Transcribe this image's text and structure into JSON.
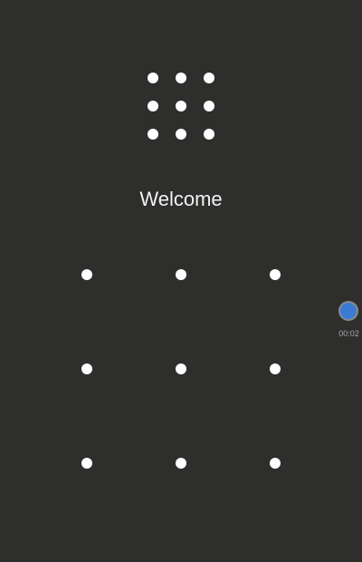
{
  "screen": {
    "title": "Welcome"
  },
  "pattern_preview": {
    "rows": 3,
    "cols": 3
  },
  "pattern_lock": {
    "rows": 3,
    "cols": 3
  },
  "recording_indicator": {
    "time": "00:02",
    "color": "#3a7bd5"
  },
  "colors": {
    "background": "#2e2f2d",
    "dot": "#ffffff",
    "text": "#f2f2f2"
  }
}
